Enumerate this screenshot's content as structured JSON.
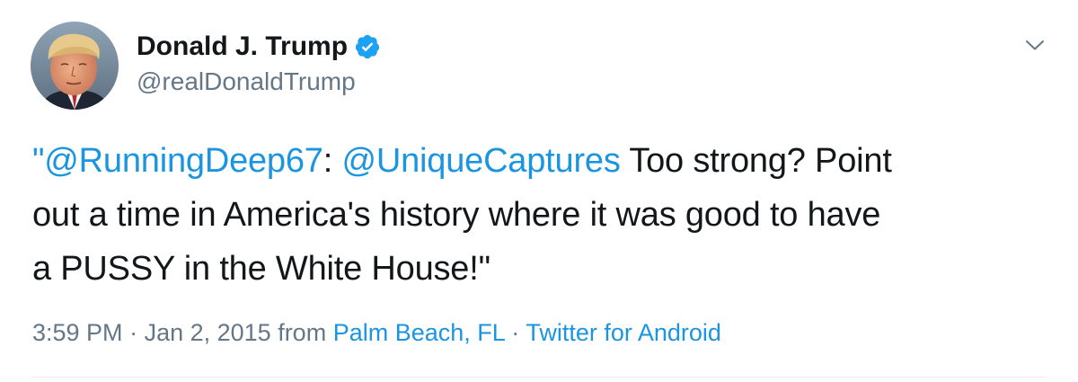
{
  "author": {
    "display_name": "Donald J. Trump",
    "handle": "@realDonaldTrump",
    "verified": true,
    "verified_color": "#1da1f2"
  },
  "tweet": {
    "open_quote": "\"",
    "mention_1": "@RunningDeep67",
    "colon": ":",
    "mention_2": "@UniqueCaptures",
    "line1_rest": " Too strong? Point",
    "line2": "out a time in America's history where it was good to have",
    "line3": "a PUSSY in the White House!\""
  },
  "meta": {
    "time": "3:59 PM",
    "separator": " · ",
    "date": "Jan 2, 2015",
    "from_label": " from ",
    "location": "Palm Beach, FL",
    "separator_2": " · ",
    "source": "Twitter for Android"
  },
  "icons": {
    "menu": "chevron-down-icon",
    "verified": "verified-badge-icon",
    "avatar": "profile-photo"
  },
  "colors": {
    "link": "#1b95e0",
    "secondary_text": "#657786",
    "primary_text": "#14171a"
  }
}
